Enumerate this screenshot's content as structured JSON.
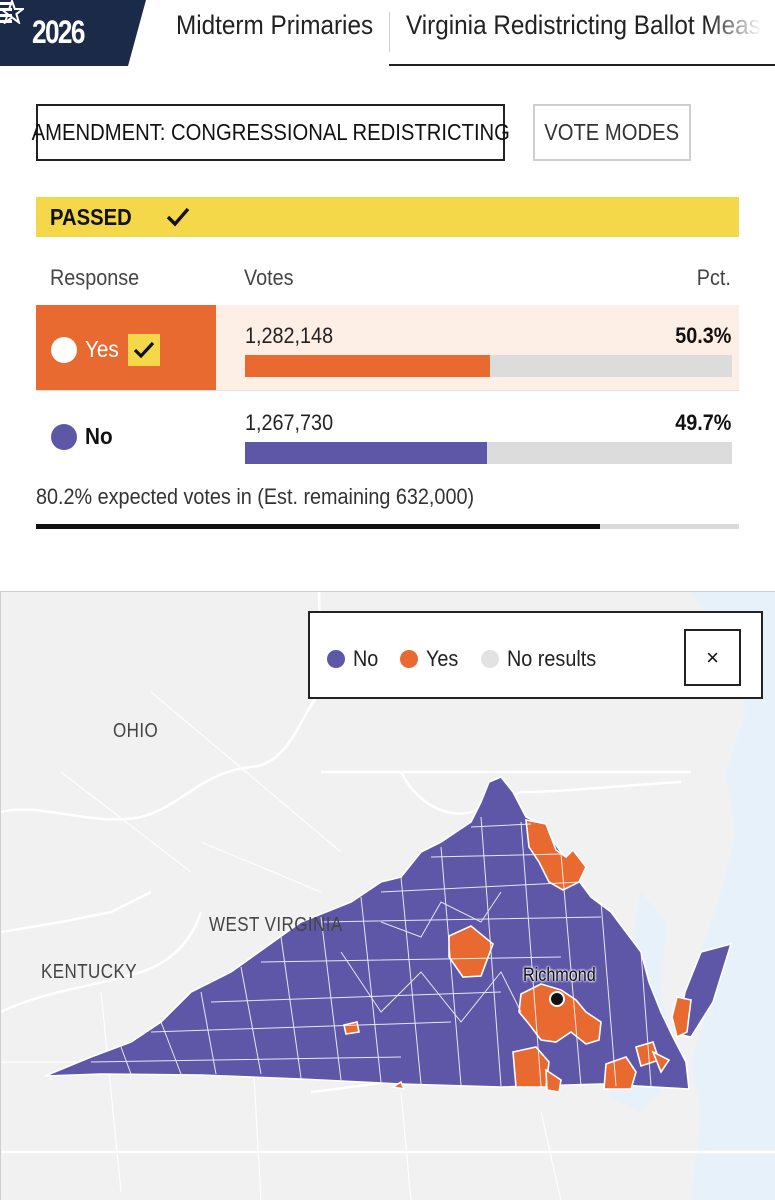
{
  "nav": {
    "logo_text": "2026",
    "tabs": [
      {
        "label": "Midterm Primaries"
      },
      {
        "label": "Virginia Redistricting Ballot Meas"
      }
    ]
  },
  "controls": {
    "race_selector": "AMENDMENT: CONGRESSIONAL REDISTRICTING",
    "vote_modes": "VOTE MODES"
  },
  "status": {
    "label": "PASSED"
  },
  "table": {
    "headers": {
      "response": "Response",
      "votes": "Votes",
      "pct": "Pct."
    },
    "rows": [
      {
        "response": "Yes",
        "votes": "1,282,148",
        "pct": "50.3%",
        "share": 50.3,
        "winner": true,
        "color": "#e86a30"
      },
      {
        "response": "No",
        "votes": "1,267,730",
        "pct": "49.7%",
        "share": 49.7,
        "winner": false,
        "color": "#5e57a8"
      }
    ]
  },
  "reporting": {
    "text": "80.2% expected votes in (Est. remaining 632,000)",
    "expected_in_pct": 80.2
  },
  "map": {
    "states": {
      "ohio": "OHIO",
      "west_virginia": "WEST VIRGINIA",
      "kentucky": "KENTUCKY"
    },
    "city": "Richmond",
    "legend": [
      {
        "label": "No",
        "color": "#5e57a8"
      },
      {
        "label": "Yes",
        "color": "#e86a30"
      },
      {
        "label": "No results",
        "color": "#e2e2e2"
      }
    ],
    "close_label": "×"
  },
  "colors": {
    "yes": "#e86a30",
    "no": "#5e57a8",
    "passed_banner": "#f5d84a",
    "logo_bg": "#1c2a4a"
  }
}
